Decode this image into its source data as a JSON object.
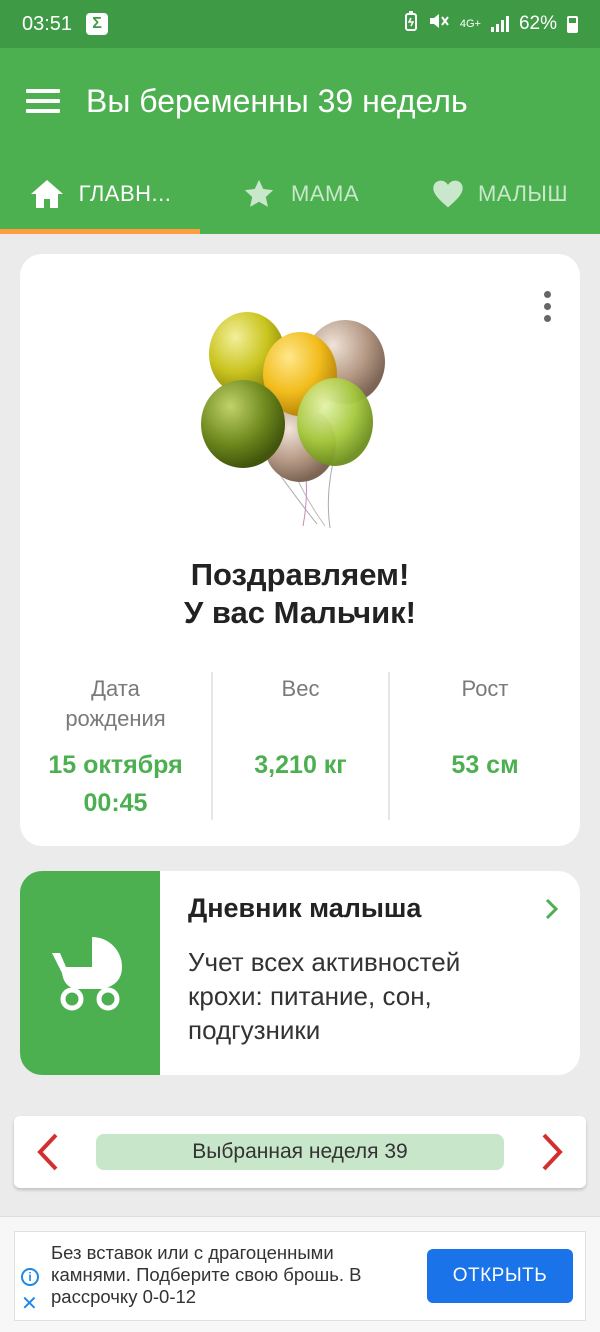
{
  "status_bar": {
    "time": "03:51",
    "notification_icon": "sigma-icon",
    "network": "4G+",
    "battery": "62%"
  },
  "app_bar": {
    "title": "Вы беременны 39 недель",
    "menu_icon": "menu-icon"
  },
  "tabs": [
    {
      "label": "ГЛАВН...",
      "icon": "home-icon",
      "active": true
    },
    {
      "label": "МАМА",
      "icon": "star-icon",
      "active": false
    },
    {
      "label": "МАЛЫШ",
      "icon": "heart-icon",
      "active": false
    }
  ],
  "congrats": {
    "line1": "Поздравляем!",
    "line2": "У вас Мальчик!",
    "stats": [
      {
        "label_line1": "Дата",
        "label_line2": "рождения",
        "value_line1": "15 октября",
        "value_line2": "00:45"
      },
      {
        "label_line1": "Вес",
        "value_line1": "3,210 кг"
      },
      {
        "label_line1": "Рост",
        "value_line1": "53 см"
      }
    ]
  },
  "diary": {
    "title": "Дневник малыша",
    "description": "Учет всех активностей крохи: питание, сон, подгузники",
    "icon": "stroller-icon"
  },
  "week_selector": {
    "label": "Выбранная неделя 39"
  },
  "ad": {
    "text": "Без вставок или с драгоценными камнями. Подберите свою брошь. В рассрочку 0-0-12",
    "button": "ОТКРЫТЬ",
    "close": "✕",
    "info": "i"
  },
  "colors": {
    "status_bar": "#3f9a45",
    "primary": "#4caf50",
    "tab_indicator": "#ff9e40",
    "week_pill": "#c8e6c9",
    "arrow_red": "#d32f2f",
    "ad_button": "#1a73e8"
  }
}
